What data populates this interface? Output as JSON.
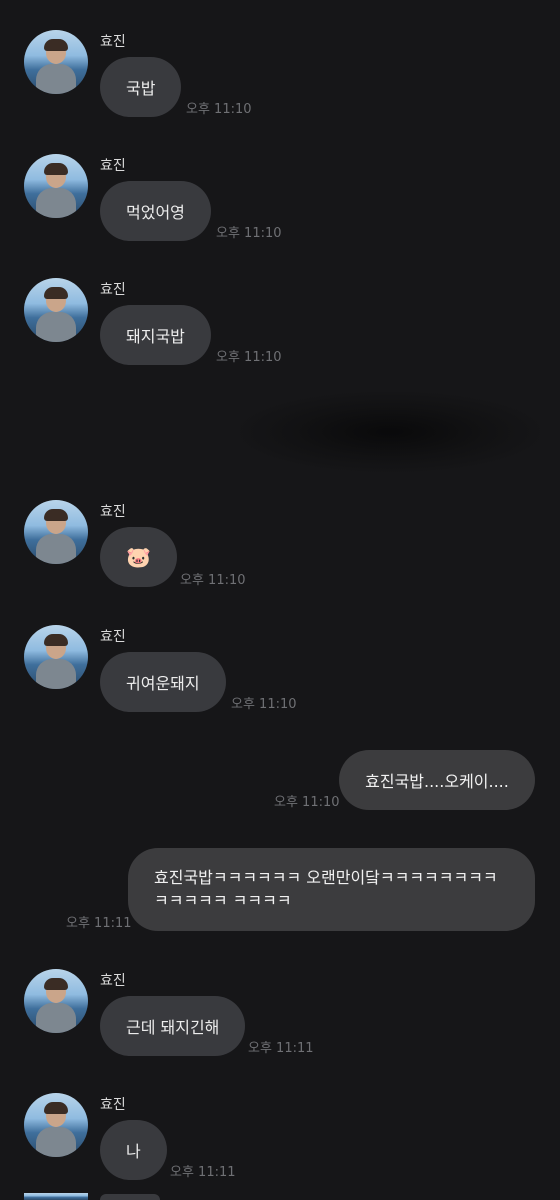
{
  "sender_name": "효진",
  "messages_in": [
    {
      "text": "국밥",
      "time": "오후 11:10"
    },
    {
      "text": "먹었어영",
      "time": "오후 11:10"
    },
    {
      "text": "돼지국밥",
      "time": "오후 11:10"
    },
    {
      "text": "🐷",
      "time": "오후 11:10"
    },
    {
      "text": "귀여운돼지",
      "time": "오후 11:10"
    },
    {
      "text": "근데 돼지긴해",
      "time": "오후 11:11"
    },
    {
      "text": "나",
      "time": "오후 11:11"
    }
  ],
  "messages_out": [
    {
      "text": "효진국밥....오케이....",
      "time": "오후 11:10"
    },
    {
      "text": "효진국밥ㅋㅋㅋㅋㅋㅋ 오랜만이닼ㅋㅋㅋㅋㅋㅋㅋㅋㅋㅋㅋㅋㅋ ㅋㅋㅋㅋ",
      "time": "오후 11:11"
    }
  ],
  "colors": {
    "background": "#161618",
    "bubble": "#393a3e",
    "timestamp": "#6f7074"
  }
}
